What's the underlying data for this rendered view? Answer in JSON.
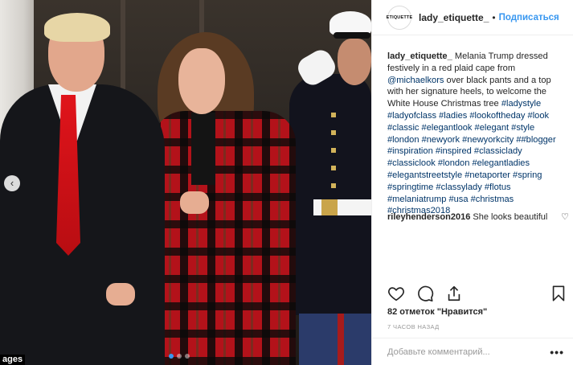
{
  "header": {
    "avatar_text": "ETIQUETTE",
    "username": "lady_etiquette_",
    "separator": "•",
    "follow_label": "Подписаться"
  },
  "photo": {
    "watermark": "ages",
    "prev_icon": "chevron-left-icon",
    "dots_count": 3,
    "active_dot": 0
  },
  "caption": {
    "username": "lady_etiquette_",
    "text_1": " Melania Trump dressed festively in a red plaid cape from ",
    "mention": "@michaelkors",
    "text_2": " over black pants and a top with her signature heels, to welcome the White House Christmas tree ",
    "hashtags": "#ladystyle #ladyofclass #ladies #lookoftheday #look #classic #elegantlook #elegant #style #london #newyork #newyorkcity ##blogger #inspiration #inspired #classiclady #classiclook #london #elegantladies #elegantstreetstyle #netaporter #spring #springtime #classylady #flotus #melaniatrump #usa #christmas #christmas2018"
  },
  "comments": [
    {
      "username": "rileyhenderson2016",
      "text": " She looks beautiful"
    }
  ],
  "actions": {
    "like_icon": "heart-icon",
    "comment_icon": "comment-icon",
    "share_icon": "share-icon",
    "save_icon": "bookmark-icon"
  },
  "likes_text": "82 отметок \"Нравится\"",
  "time_ago": "7 ЧАСОВ НАЗАД",
  "comment_input": {
    "placeholder": "Добавьте комментарий...",
    "value": ""
  },
  "more_label": "•••",
  "colors": {
    "link": "#003569",
    "follow": "#3897f0",
    "muted": "#999999",
    "text": "#262626"
  }
}
